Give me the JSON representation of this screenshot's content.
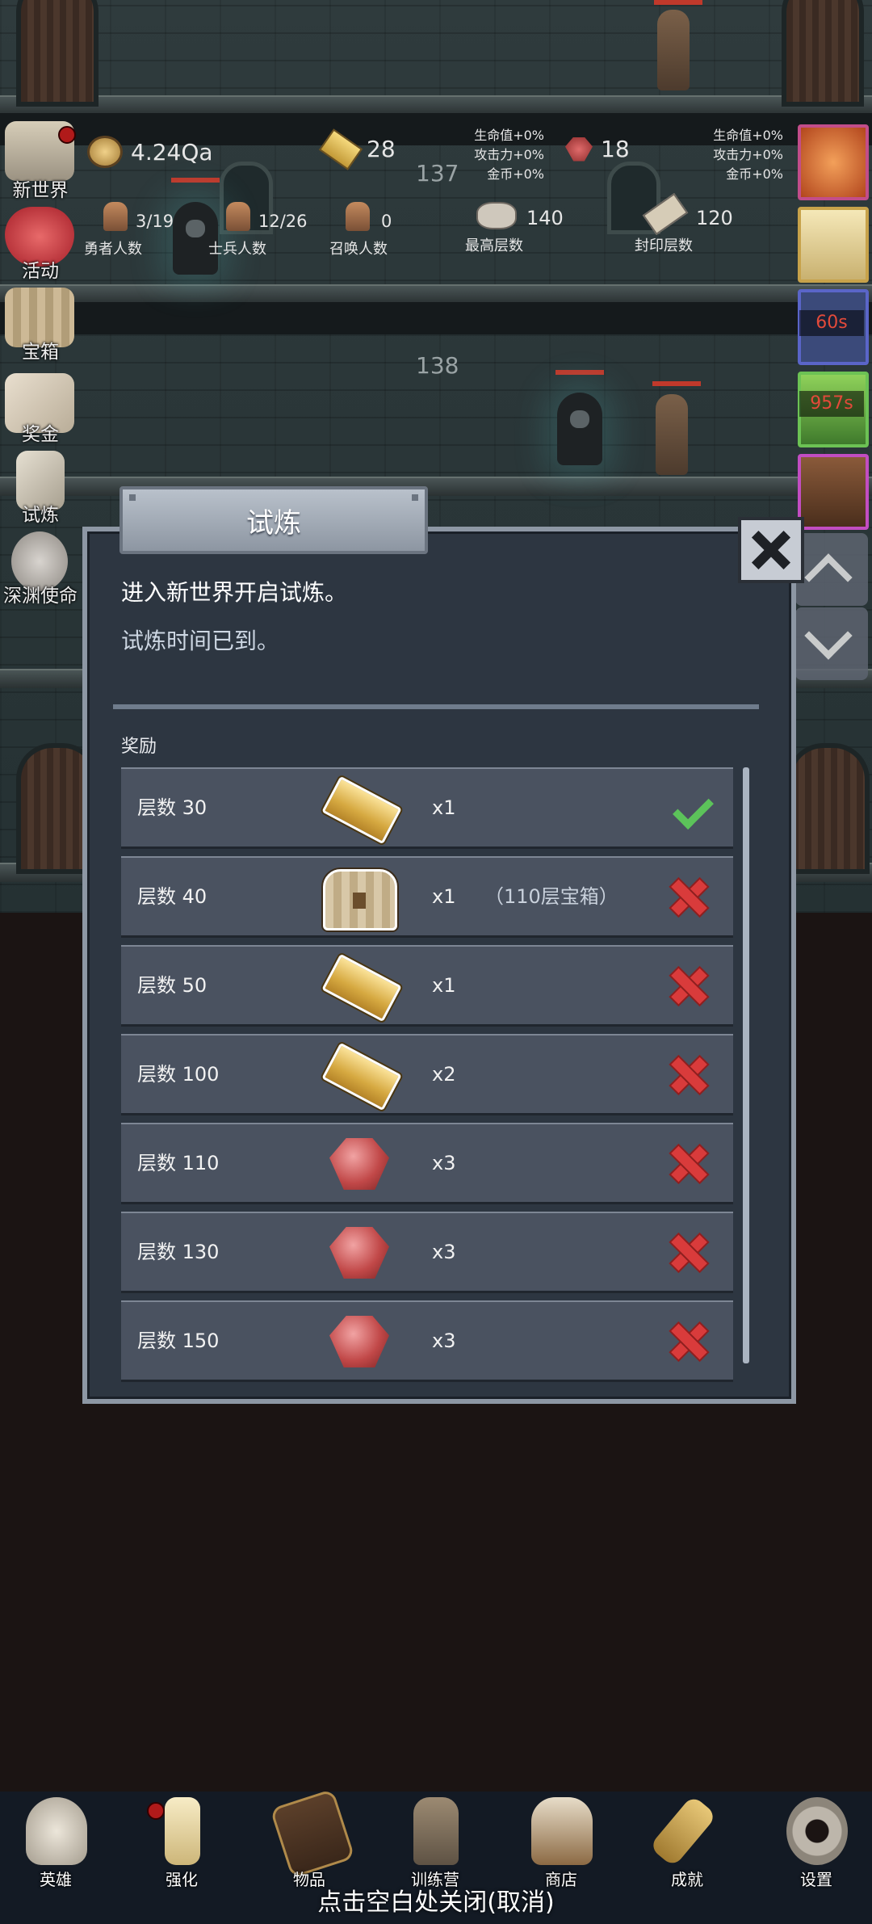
{
  "header": {
    "floor_upper": "137",
    "floor_mid": "138",
    "coins": "4.24Qa",
    "gold_bars": "28",
    "gems": "18",
    "bonus_left": [
      "生命值+0%",
      "攻击力+0%",
      "金币+0%"
    ],
    "bonus_right": [
      "生命值+0%",
      "攻击力+0%",
      "金币+0%"
    ],
    "heroes": {
      "value": "3/19",
      "label": "勇者人数"
    },
    "soldiers": {
      "value": "12/26",
      "label": "士兵人数"
    },
    "summons": {
      "value": "0",
      "label": "召唤人数"
    },
    "max_floor": {
      "value": "140",
      "label": "最高层数"
    },
    "seal_floor": {
      "value": "120",
      "label": "封印层数"
    }
  },
  "side_menu": [
    {
      "label": "新世界",
      "icon": "gravestone-icon",
      "badge": true
    },
    {
      "label": "活动",
      "icon": "heart-icon"
    },
    {
      "label": "宝箱",
      "icon": "treasure-chest-icon"
    },
    {
      "label": "奖金",
      "icon": "envelope-icon"
    },
    {
      "label": "试炼",
      "icon": "feather-icon"
    },
    {
      "label": "深渊使命",
      "icon": "orb-icon"
    }
  ],
  "buffs": [
    {
      "icon": "pumpkin-icon"
    },
    {
      "icon": "candle-icon"
    },
    {
      "icon": "shield-icon",
      "timer": "60s"
    },
    {
      "icon": "grass-icon",
      "timer": "957s"
    },
    {
      "icon": "chest-buff-icon"
    }
  ],
  "modal": {
    "title": "试炼",
    "desc1": "进入新世界开启试炼。",
    "desc2": "试炼时间已到。",
    "reward_label": "奖励",
    "rows": [
      {
        "floor": "层数 30",
        "icon": "gold-bar-icon",
        "qty": "x1",
        "note": "",
        "claimed": true
      },
      {
        "floor": "层数 40",
        "icon": "treasure-chest-icon",
        "qty": "x1",
        "note": "（110层宝箱）",
        "claimed": false
      },
      {
        "floor": "层数 50",
        "icon": "gold-bar-icon",
        "qty": "x1",
        "note": "",
        "claimed": false
      },
      {
        "floor": "层数 100",
        "icon": "gold-bar-icon",
        "qty": "x2",
        "note": "",
        "claimed": false
      },
      {
        "floor": "层数 110",
        "icon": "gem-icon",
        "qty": "x3",
        "note": "",
        "claimed": false
      },
      {
        "floor": "层数 130",
        "icon": "gem-icon",
        "qty": "x3",
        "note": "",
        "claimed": false
      },
      {
        "floor": "层数 150",
        "icon": "gem-icon",
        "qty": "x3",
        "note": "",
        "claimed": false
      }
    ]
  },
  "tabs": [
    {
      "label": "英雄",
      "icon": "skull-icon"
    },
    {
      "label": "强化",
      "icon": "candle-icon",
      "badge": true
    },
    {
      "label": "物品",
      "icon": "book-icon"
    },
    {
      "label": "训练营",
      "icon": "lantern-icon"
    },
    {
      "label": "商店",
      "icon": "mug-icon"
    },
    {
      "label": "成就",
      "icon": "key-icon"
    },
    {
      "label": "设置",
      "icon": "gear-icon"
    }
  ],
  "hint": "点击空白处关闭(取消)",
  "colors": {
    "cross": "#d93b3b",
    "check": "#5cc35a",
    "timer": "#e34a3a",
    "panel": "#2d3641"
  }
}
